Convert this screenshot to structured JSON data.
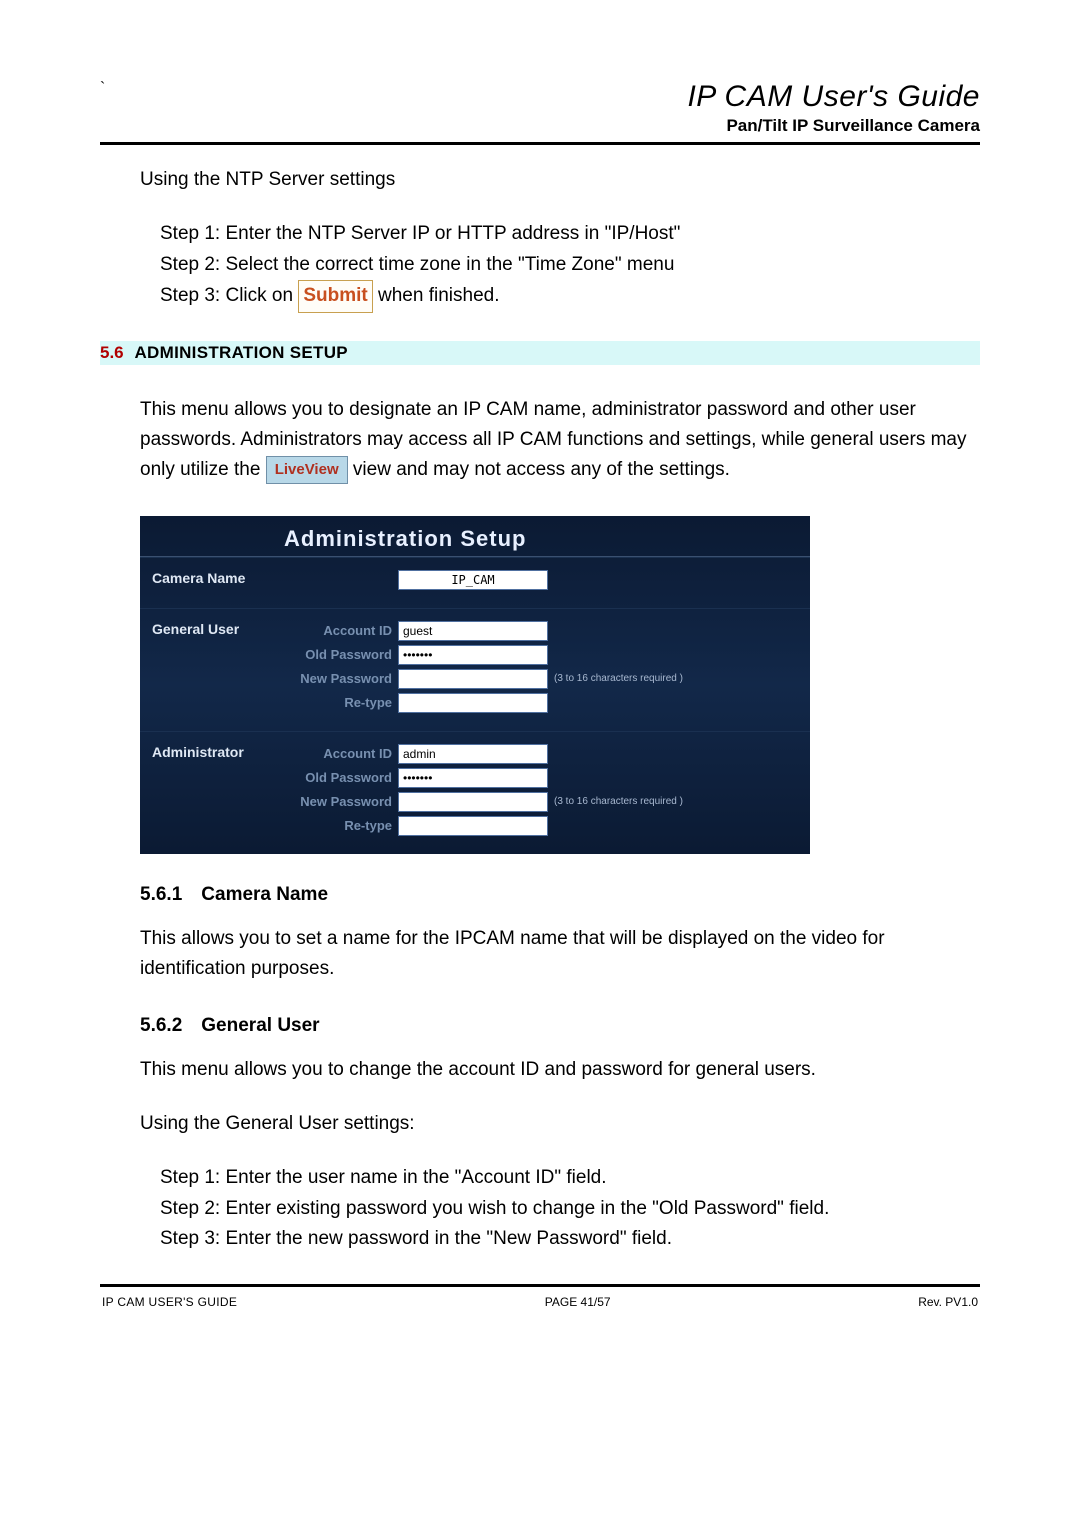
{
  "header": {
    "title": "IP CAM User's Guide",
    "subtitle": "Pan/Tilt IP Surveillance Camera"
  },
  "tick": "`",
  "intro": {
    "ntp_heading": "Using the NTP Server settings",
    "step1": "Step 1: Enter the NTP Server IP or HTTP address in \"IP/Host\"",
    "step2": "Step 2: Select the correct time zone in the \"Time Zone\" menu",
    "step3_pre": "Step 3: Click on ",
    "submit": "Submit",
    "step3_post": " when finished."
  },
  "section56": {
    "num": "5.6",
    "title": "ADMINISTRATION SETUP",
    "para_pre": "This menu allows you to designate an IP CAM name, administrator password and other user passwords. Administrators may access all IP CAM functions and settings, while general users may only utilize the ",
    "liveview": "LiveView",
    "para_post": " view and may not access any of the settings."
  },
  "panel": {
    "title": "Administration Setup",
    "camera_name_label": "Camera Name",
    "camera_name_value": "IP_CAM",
    "general_user_label": "General User",
    "admin_label": "Administrator",
    "fields": {
      "account_id": "Account ID",
      "old_password": "Old Password",
      "new_password": "New Password",
      "retype": "Re-type"
    },
    "general": {
      "account_id": "guest",
      "old_password": "•••••••",
      "new_password": "",
      "retype": ""
    },
    "admin": {
      "account_id": "admin",
      "old_password": "•••••••",
      "new_password": "",
      "retype": ""
    },
    "note": "(3 to 16 characters required )"
  },
  "s561": {
    "num": "5.6.1",
    "title": "Camera Name",
    "para": "This allows you to set a name for the IPCAM name that will be displayed on the video for identification purposes."
  },
  "s562": {
    "num": "5.6.2",
    "title": "General User",
    "para1": "This menu allows you to change the account ID and password for general users.",
    "para2": "Using the General User settings:",
    "step1": "Step 1: Enter the user name in the \"Account ID\" field.",
    "step2": "Step 2: Enter existing password you wish to change in the \"Old Password\" field.",
    "step3": "Step 3: Enter the new password in the \"New Password\" field."
  },
  "footer": {
    "left": "IP CAM USER'S GUIDE",
    "center_pre": "PAGE ",
    "page": "41/57",
    "right": "Rev. PV1.0"
  }
}
